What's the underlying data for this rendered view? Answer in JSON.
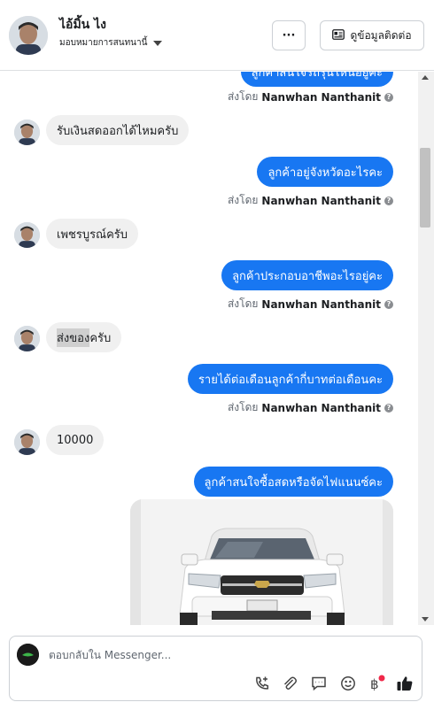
{
  "header": {
    "contact_name": "ไอ้มิ้น ไง",
    "assign_label": "มอบหมายการสนทนานี้",
    "more_label": "···",
    "contact_info_label": "ดูข้อมูลติดต่อ"
  },
  "messages": [
    {
      "dir": "out",
      "text": "ลูกค้าสนใจรถรุ่นไหนอยู่คะ"
    },
    {
      "dir": "in",
      "text": "รับเงินสดออกได้ไหมครับ"
    },
    {
      "dir": "out",
      "text": "ลูกค้าอยู่จังหวัดอะไรคะ"
    },
    {
      "dir": "in",
      "text": "เพชรบูรณ์ครับ"
    },
    {
      "dir": "out",
      "text": "ลูกค้าประกอบอาชีพอะไรอยู่คะ"
    },
    {
      "dir": "in",
      "text_highlight": "ส่งของ",
      "text_rest": "ครับ"
    },
    {
      "dir": "out",
      "text": "รายได้ต่อเดือนลูกค้ากี่บาทต่อเดือนคะ"
    },
    {
      "dir": "in",
      "text": "10000"
    },
    {
      "dir": "out",
      "text": "ลูกค้าสนใจซื้อสดหรือจัดไฟแนนซ์คะ"
    }
  ],
  "sent_by": {
    "prefix": "ส่งโดย",
    "name": "Nanwhan Nanthanit"
  },
  "composer": {
    "placeholder": "ตอบกลับใน Messenger..."
  },
  "icons": [
    "phone-plus-icon",
    "attachment-icon",
    "comment-icon",
    "emoji-icon",
    "baht-icon",
    "thumbs-up-icon"
  ],
  "colors": {
    "accent": "#1877f2",
    "incoming_bubble": "#f0f0f0",
    "notification_dot": "#f02849"
  }
}
